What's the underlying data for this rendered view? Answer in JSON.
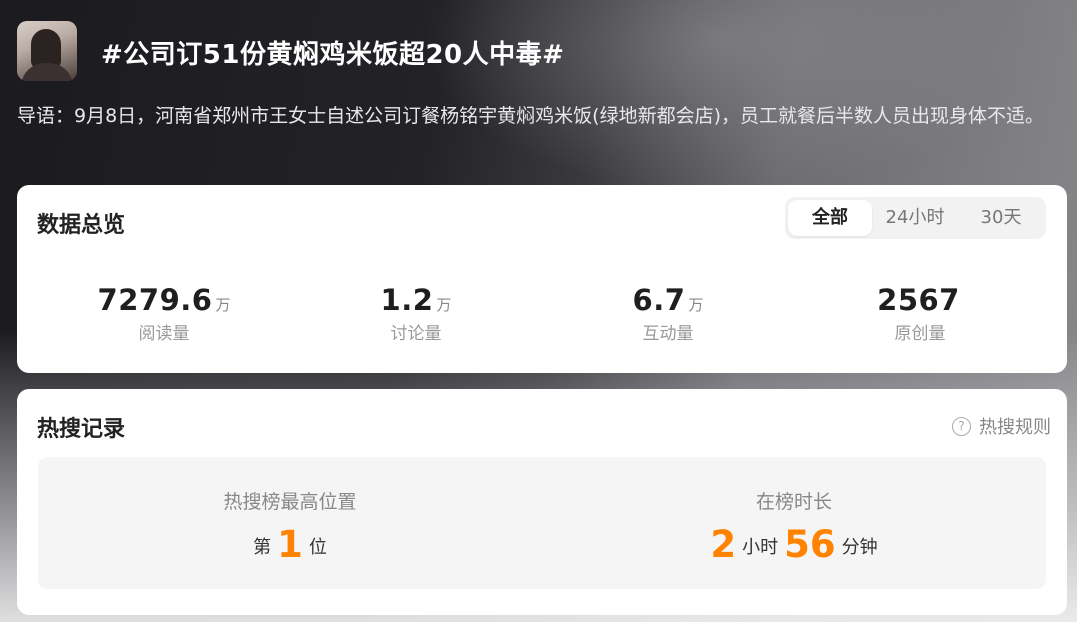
{
  "header": {
    "title": "#公司订51份黄焖鸡米饭超20人中毒#"
  },
  "intro": {
    "text": "导语：9月8日，河南省郑州市王女士自述公司订餐杨铭宇黄焖鸡米饭(绿地新都会店)，员工就餐后半数人员出现身体不适。"
  },
  "overview": {
    "title": "数据总览",
    "tabs": [
      "全部",
      "24小时",
      "30天"
    ],
    "active_tab": "全部",
    "stats": [
      {
        "value": "7279.6",
        "unit": "万",
        "label": "阅读量"
      },
      {
        "value": "1.2",
        "unit": "万",
        "label": "讨论量"
      },
      {
        "value": "6.7",
        "unit": "万",
        "label": "互动量"
      },
      {
        "value": "2567",
        "unit": "",
        "label": "原创量"
      }
    ]
  },
  "hot": {
    "title": "热搜记录",
    "rules_label": "热搜规则",
    "highest_rank": {
      "label": "热搜榜最高位置",
      "prefix": "第",
      "value": "1",
      "suffix": "位"
    },
    "duration": {
      "label": "在榜时长",
      "hours": "2",
      "hours_unit": "小时",
      "minutes": "56",
      "minutes_unit": "分钟"
    }
  },
  "colors": {
    "accent": "#ff8200",
    "card_bg": "#ffffff"
  },
  "icons": {
    "help": "question-circle-icon"
  }
}
